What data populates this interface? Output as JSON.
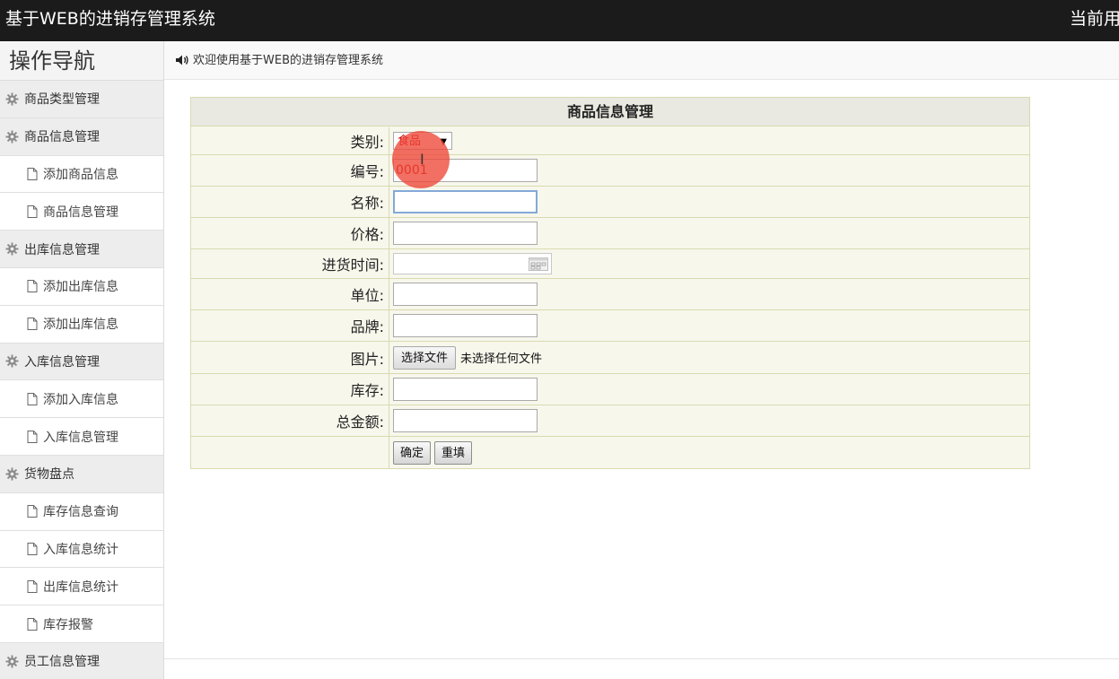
{
  "header": {
    "app_title": "基于WEB的进销存管理系统",
    "user_label": "当前用"
  },
  "sidebar": {
    "title": "操作导航",
    "items": [
      {
        "label": "商品类型管理",
        "kind": "group",
        "icon": "gear-icon"
      },
      {
        "label": "商品信息管理",
        "kind": "group",
        "icon": "gear-icon"
      },
      {
        "label": "添加商品信息",
        "kind": "sub",
        "icon": "document-icon"
      },
      {
        "label": "商品信息管理",
        "kind": "sub",
        "icon": "document-icon"
      },
      {
        "label": "出库信息管理",
        "kind": "group",
        "icon": "gear-icon"
      },
      {
        "label": "添加出库信息",
        "kind": "sub",
        "icon": "document-icon"
      },
      {
        "label": "添加出库信息",
        "kind": "sub",
        "icon": "document-icon"
      },
      {
        "label": "入库信息管理",
        "kind": "group",
        "icon": "gear-icon"
      },
      {
        "label": "添加入库信息",
        "kind": "sub",
        "icon": "document-icon"
      },
      {
        "label": "入库信息管理",
        "kind": "sub",
        "icon": "document-icon"
      },
      {
        "label": "货物盘点",
        "kind": "group",
        "icon": "gear-icon"
      },
      {
        "label": "库存信息查询",
        "kind": "sub",
        "icon": "document-icon"
      },
      {
        "label": "入库信息统计",
        "kind": "sub",
        "icon": "document-icon"
      },
      {
        "label": "出库信息统计",
        "kind": "sub",
        "icon": "document-icon"
      },
      {
        "label": "库存报警",
        "kind": "sub",
        "icon": "document-icon"
      },
      {
        "label": "员工信息管理",
        "kind": "group",
        "icon": "gear-icon"
      }
    ]
  },
  "breadcrumb": {
    "icon": "speaker-icon",
    "text": "欢迎使用基于WEB的进销存管理系统"
  },
  "form": {
    "title": "商品信息管理",
    "category_label": "类别:",
    "category_value": "食品",
    "code_label": "编号:",
    "code_value": "0001",
    "name_label": "名称:",
    "name_value": "",
    "price_label": "价格:",
    "price_value": "",
    "purchase_time_label": "进货时间:",
    "unit_label": "单位:",
    "unit_value": "",
    "brand_label": "品牌:",
    "brand_value": "",
    "image_label": "图片:",
    "file_button": "选择文件",
    "file_status": "未选择任何文件",
    "stock_label": "库存:",
    "stock_value": "",
    "total_label": "总金额:",
    "total_value": "",
    "confirm_button": "确定",
    "reset_button": "重填"
  },
  "colors": {
    "topbar": "#1b1b1b",
    "form_bg": "#f7f7ec",
    "form_border": "#d9dab0",
    "click_indicator": "#ee4637"
  }
}
